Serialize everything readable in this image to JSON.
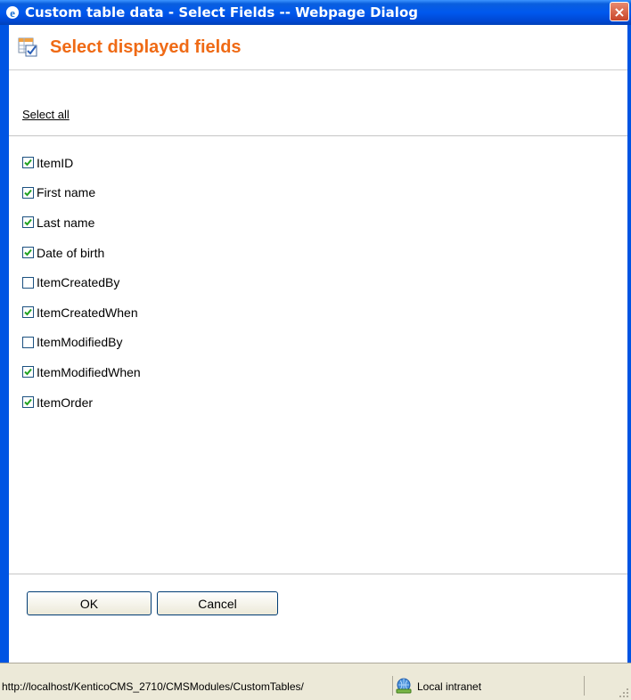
{
  "window": {
    "title": "Custom table data - Select Fields -- Webpage Dialog",
    "close_label": "×"
  },
  "header": {
    "title": "Select displayed fields",
    "accent_color": "#ef6a15"
  },
  "select_all_label": "Select all",
  "fields": [
    {
      "label": "ItemID",
      "checked": true
    },
    {
      "label": "First name",
      "checked": true
    },
    {
      "label": "Last name",
      "checked": true
    },
    {
      "label": "Date of birth",
      "checked": true
    },
    {
      "label": "ItemCreatedBy",
      "checked": false
    },
    {
      "label": "ItemCreatedWhen",
      "checked": true
    },
    {
      "label": "ItemModifiedBy",
      "checked": false
    },
    {
      "label": "ItemModifiedWhen",
      "checked": true
    },
    {
      "label": "ItemOrder",
      "checked": true
    }
  ],
  "buttons": {
    "ok_label": "OK",
    "cancel_label": "Cancel"
  },
  "statusbar": {
    "url": "http://localhost/KenticoCMS_2710/CMSModules/CustomTables/",
    "zone_label": "Local intranet",
    "zone_icon": "intranet-globe-icon"
  }
}
